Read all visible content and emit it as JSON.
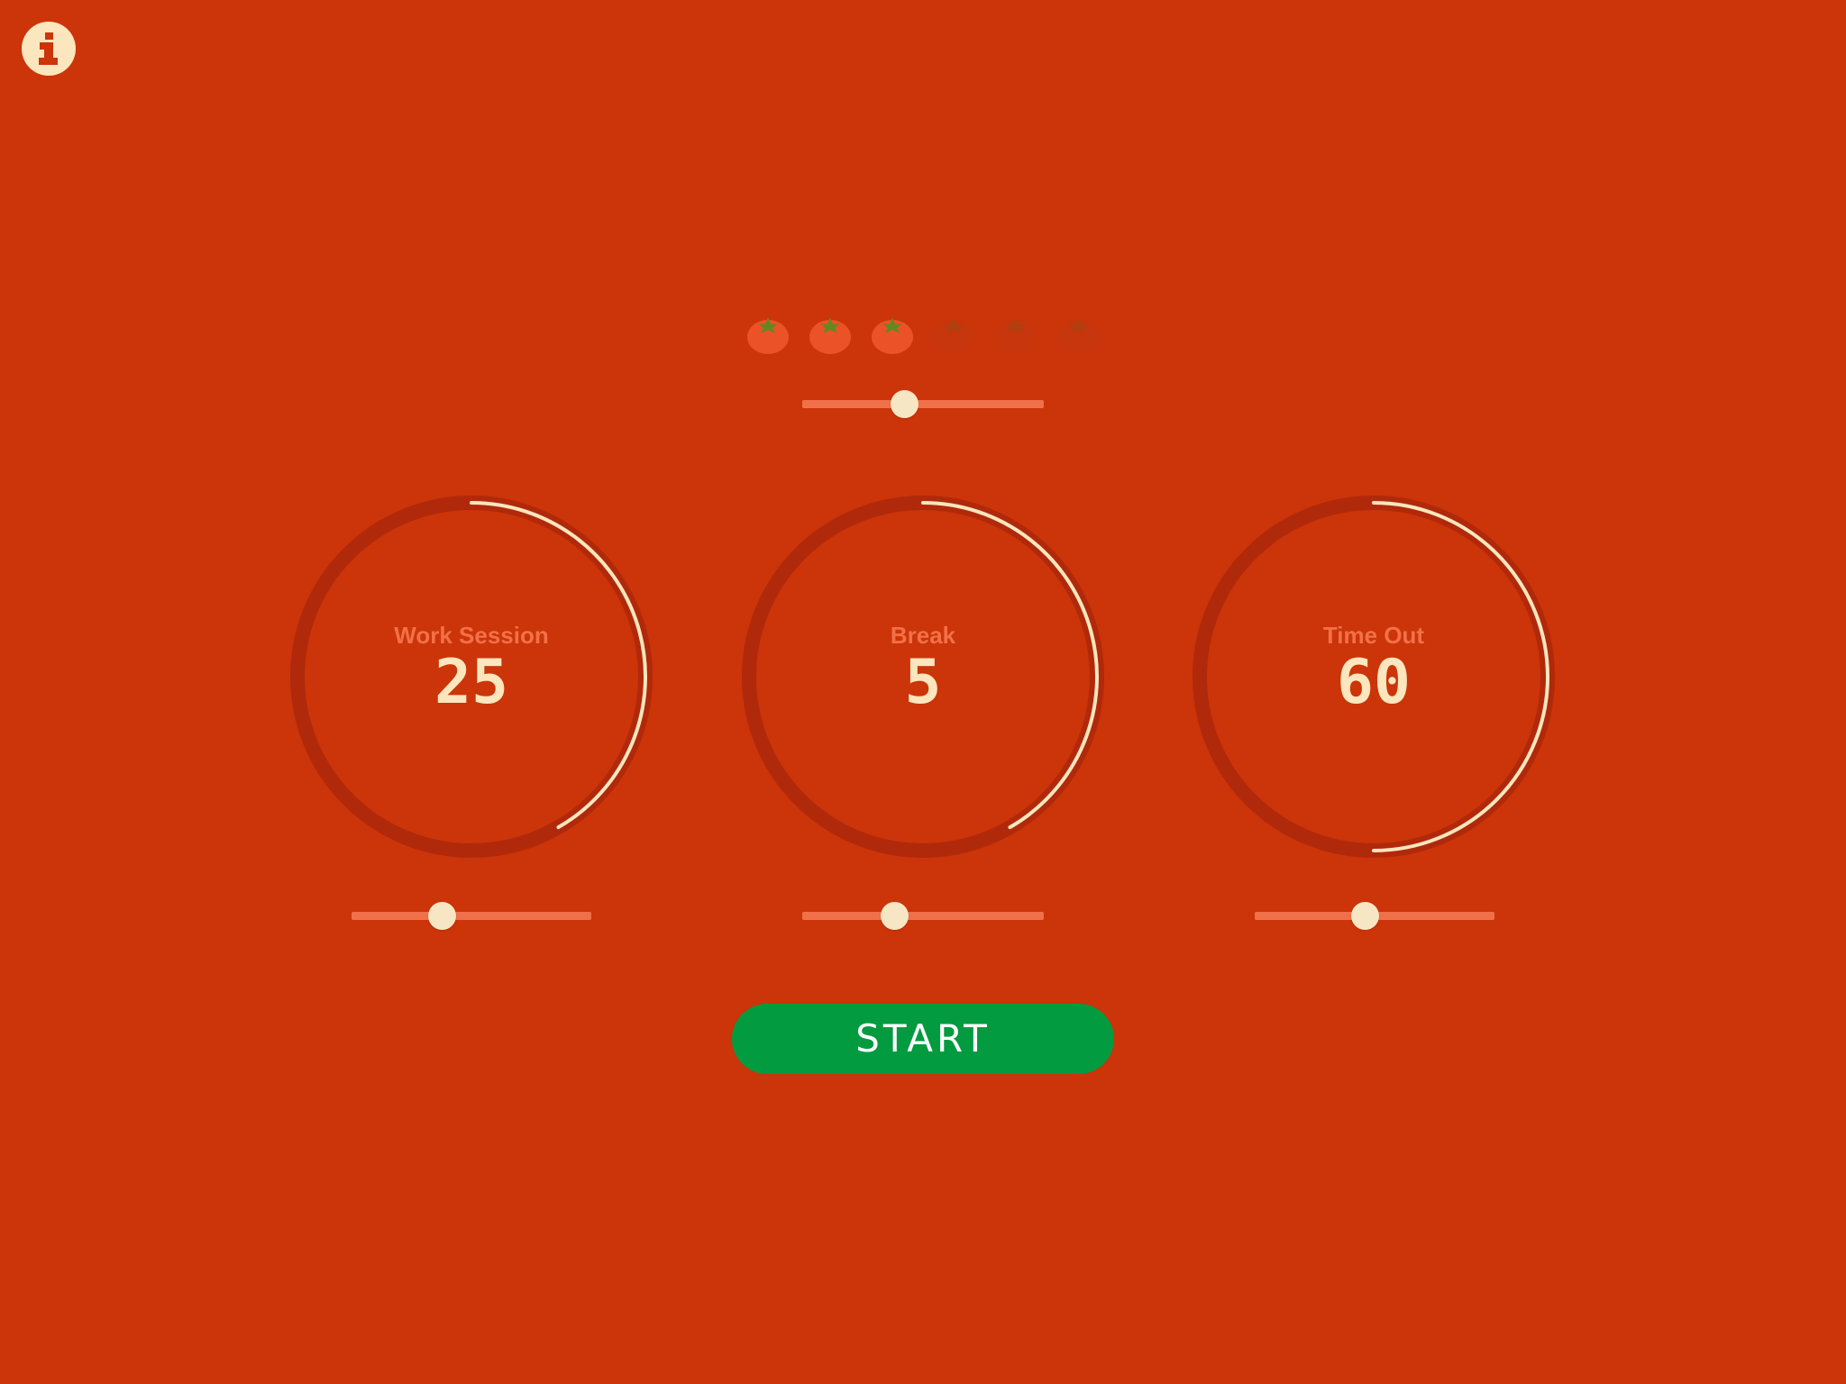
{
  "colors": {
    "background": "#cc3409",
    "ring_track": "#b0290a",
    "ring_progress": "#fbe6be",
    "slider_track": "#f0704a",
    "slider_thumb": "#f7e6c4",
    "label_text": "#f27147",
    "value_text": "#fbe6be",
    "start_button": "#029b3f",
    "tomato_active": "#ec5228",
    "tomato_inactive": "#c7360c",
    "stem_active": "#5f8a22",
    "stem_inactive": "#b0400f"
  },
  "header": {
    "info_icon": "info-icon"
  },
  "sessions": {
    "total": 6,
    "active": 3,
    "slider_fraction": 0.42
  },
  "dials": [
    {
      "id": "work",
      "label": "Work Session",
      "value": "25",
      "progress": 0.4167,
      "slider_fraction": 0.375
    },
    {
      "id": "break",
      "label": "Break",
      "value": "5",
      "progress": 0.4167,
      "slider_fraction": 0.38
    },
    {
      "id": "timeout",
      "label": "Time Out",
      "value": "60",
      "progress": 0.5,
      "slider_fraction": 0.46
    }
  ],
  "start": {
    "label": "START"
  }
}
